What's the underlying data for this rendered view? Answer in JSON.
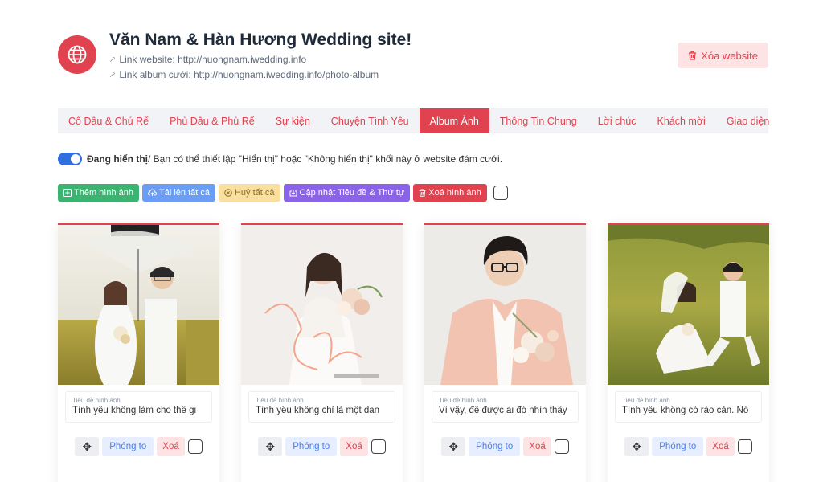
{
  "site": {
    "title": "Văn Nam & Hàn Hương Wedding site!",
    "website_link": "Link website: http://huongnam.iwedding.info",
    "album_link": "Link album cưới: http://huongnam.iwedding.info/photo-album",
    "delete_label": "Xóa website"
  },
  "tabs": [
    {
      "label": "Cô Dâu & Chú Rể",
      "active": false
    },
    {
      "label": "Phù Dâu & Phù Rể",
      "active": false
    },
    {
      "label": "Sự kiện",
      "active": false
    },
    {
      "label": "Chuyện Tình Yêu",
      "active": false
    },
    {
      "label": "Album Ảnh",
      "active": true
    },
    {
      "label": "Thông Tin Chung",
      "active": false
    },
    {
      "label": "Lời chúc",
      "active": false
    },
    {
      "label": "Khách mời",
      "active": false
    },
    {
      "label": "Giao diện",
      "active": false
    }
  ],
  "visibility": {
    "status": "Đang hiển thị",
    "description": " / Bạn có thể thiết lập \"Hiển thị\" hoặc \"Không hiển thị\" khối này ở website đám cưới.",
    "enabled": true
  },
  "actions": {
    "add": "Thêm hình ảnh",
    "upload_all": "Tải lên tất cả",
    "cancel_all": "Huỷ tất cả",
    "update": "Cập nhật Tiêu đề & Thứ tự",
    "delete": "Xoá hình ảnh"
  },
  "photos": [
    {
      "caption_label": "Tiêu đề hình ảnh",
      "caption": "Tình yêu không làm cho thế gi",
      "zoom": "Phóng to",
      "remove": "Xoá"
    },
    {
      "caption_label": "Tiêu đề hình ảnh",
      "caption": "Tình yêu không chỉ là một dan",
      "zoom": "Phóng to",
      "remove": "Xoá"
    },
    {
      "caption_label": "Tiêu đề hình ảnh",
      "caption": "Vì vậy, để được ai đó nhìn thấy",
      "zoom": "Phóng to",
      "remove": "Xoá"
    },
    {
      "caption_label": "Tiêu đề hình ảnh",
      "caption": "Tình yêu không có rào cản. Nó",
      "zoom": "Phóng to",
      "remove": "Xoá"
    }
  ],
  "colors": {
    "accent": "#e0424f",
    "toggle": "#2f6fe0",
    "tab_bar": "#f2f3f7"
  },
  "icons": {
    "badge": "globe-icon",
    "link": "link-icon",
    "delete": "trash-icon",
    "move": "move-icon"
  }
}
